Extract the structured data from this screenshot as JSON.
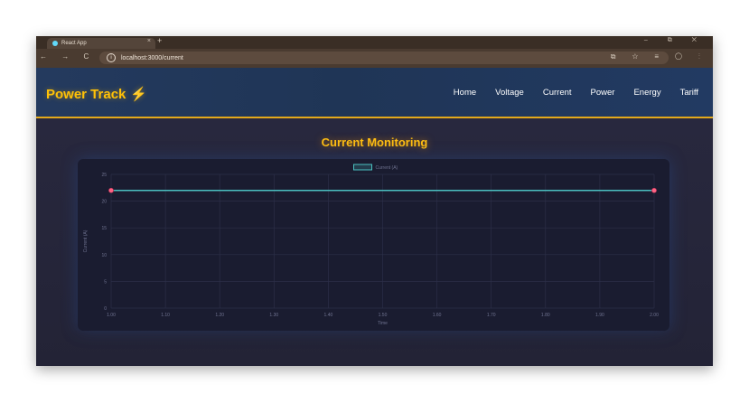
{
  "browser": {
    "tab_title": "React App",
    "tab_close": "×",
    "new_tab": "+",
    "window_controls": "–  ⧉  ✕",
    "nav_icons": "← → C ⌂",
    "url": "localhost:3000/current",
    "right_icons": "⧉ ☆ ≡ ◯ ⋮"
  },
  "navbar": {
    "brand": "Power Track",
    "brand_icon": "⚡",
    "links": [
      "Home",
      "Voltage",
      "Current",
      "Power",
      "Energy",
      "Tariff"
    ]
  },
  "page": {
    "title": "Current Monitoring"
  },
  "colors": {
    "accent": "#ffc107",
    "line": "#4bc0c0",
    "point": "#ff6384"
  },
  "chart_data": {
    "type": "line",
    "title": "",
    "xlabel": "Time",
    "ylabel": "Current (A)",
    "legend": {
      "label": "Current (A)",
      "placement": "top-center"
    },
    "xlim": [
      1.0,
      2.0
    ],
    "ylim": [
      0,
      25
    ],
    "x_ticks": [
      "1.00",
      "1.10",
      "1.20",
      "1.30",
      "1.40",
      "1.50",
      "1.60",
      "1.70",
      "1.80",
      "1.90",
      "2.00"
    ],
    "y_ticks": [
      "0",
      "5",
      "10",
      "15",
      "20",
      "25"
    ],
    "grid": true,
    "series": [
      {
        "name": "Current (A)",
        "x": [
          1.0,
          2.0
        ],
        "values": [
          22,
          22
        ]
      }
    ]
  }
}
